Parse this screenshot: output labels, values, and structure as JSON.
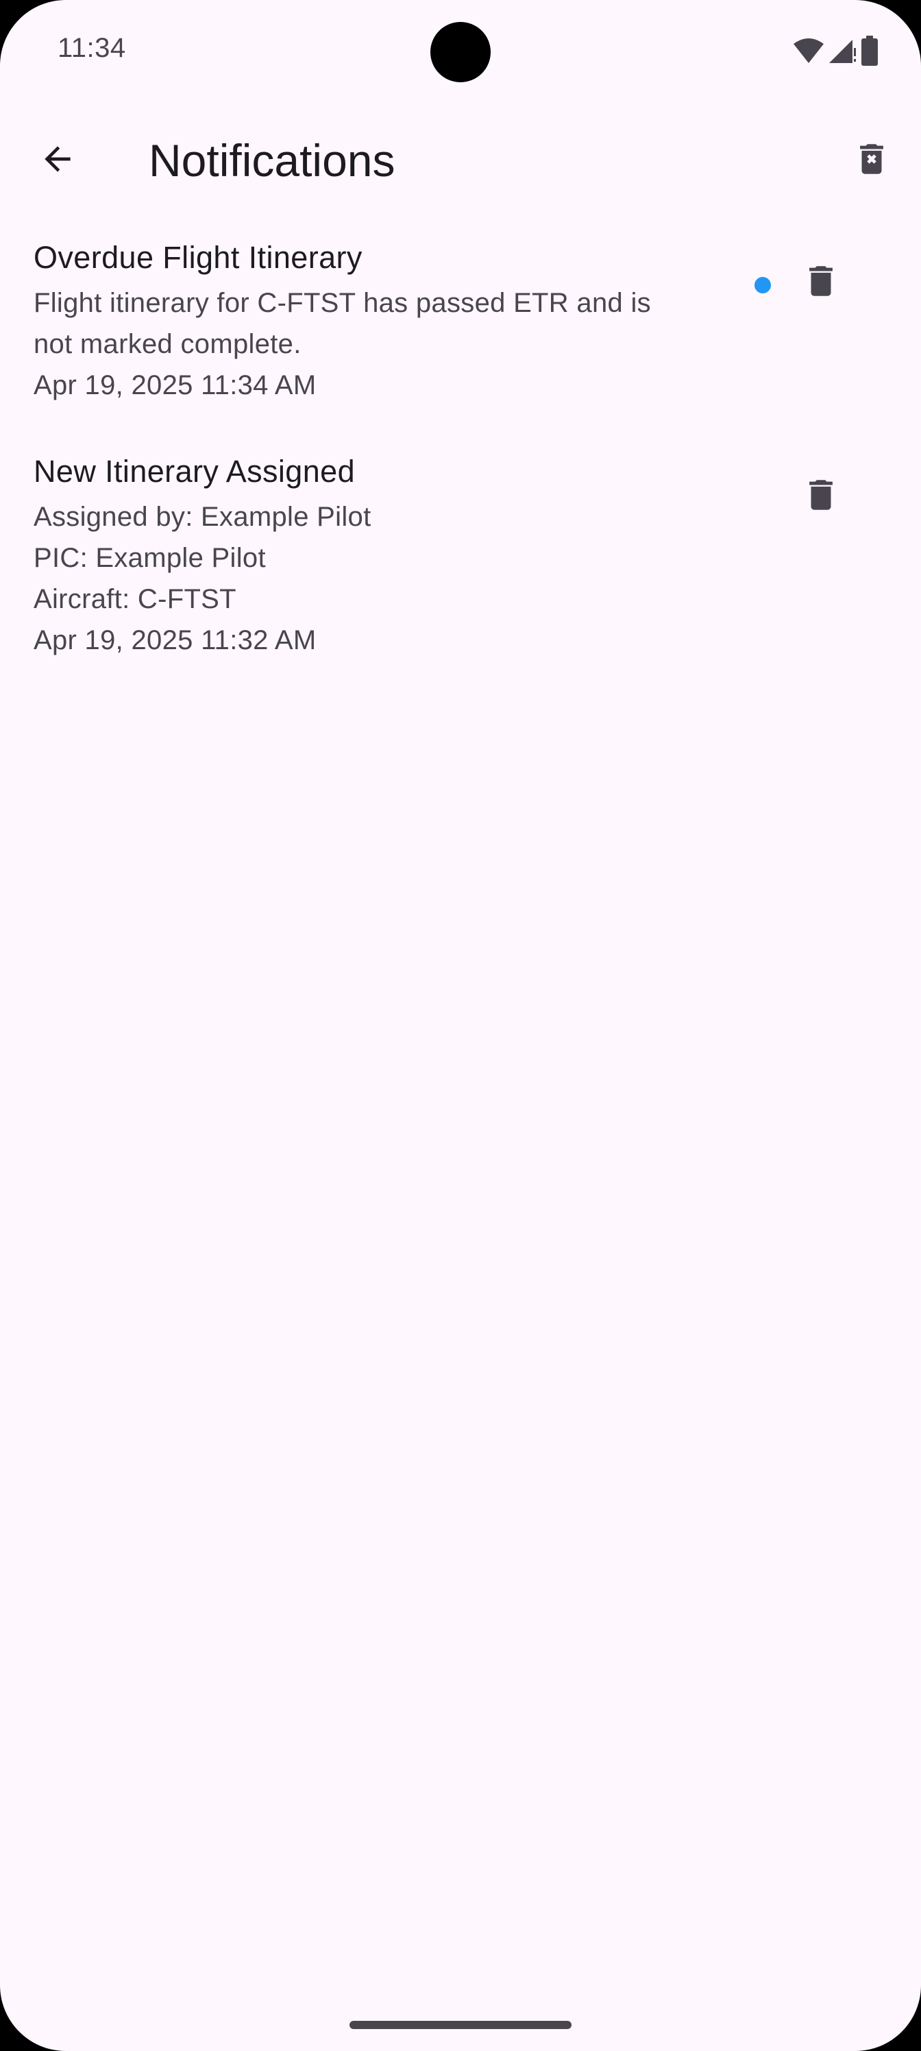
{
  "status_bar": {
    "time": "11:34",
    "icons": [
      "wifi-icon",
      "signal-icon",
      "battery-icon"
    ]
  },
  "app_bar": {
    "title": "Notifications",
    "back_icon": "arrow-back-icon",
    "clear_all_icon": "delete-forever-icon"
  },
  "notifications": [
    {
      "title": "Overdue Flight Itinerary",
      "body_lines": [
        "Flight itinerary for C-FTST has passed ETR and is",
        "not marked complete."
      ],
      "timestamp": "Apr 19, 2025 11:34 AM",
      "unread": true
    },
    {
      "title": "New Itinerary Assigned",
      "body_lines": [
        "Assigned by: Example Pilot",
        "PIC: Example Pilot",
        "Aircraft: C-FTST"
      ],
      "timestamp": "Apr 19, 2025 11:32 AM",
      "unread": false
    }
  ],
  "colors": {
    "background": "#fef7fd",
    "on_surface": "#1d1b20",
    "on_surface_variant": "#49454f",
    "unread_indicator": "#2196f3"
  }
}
